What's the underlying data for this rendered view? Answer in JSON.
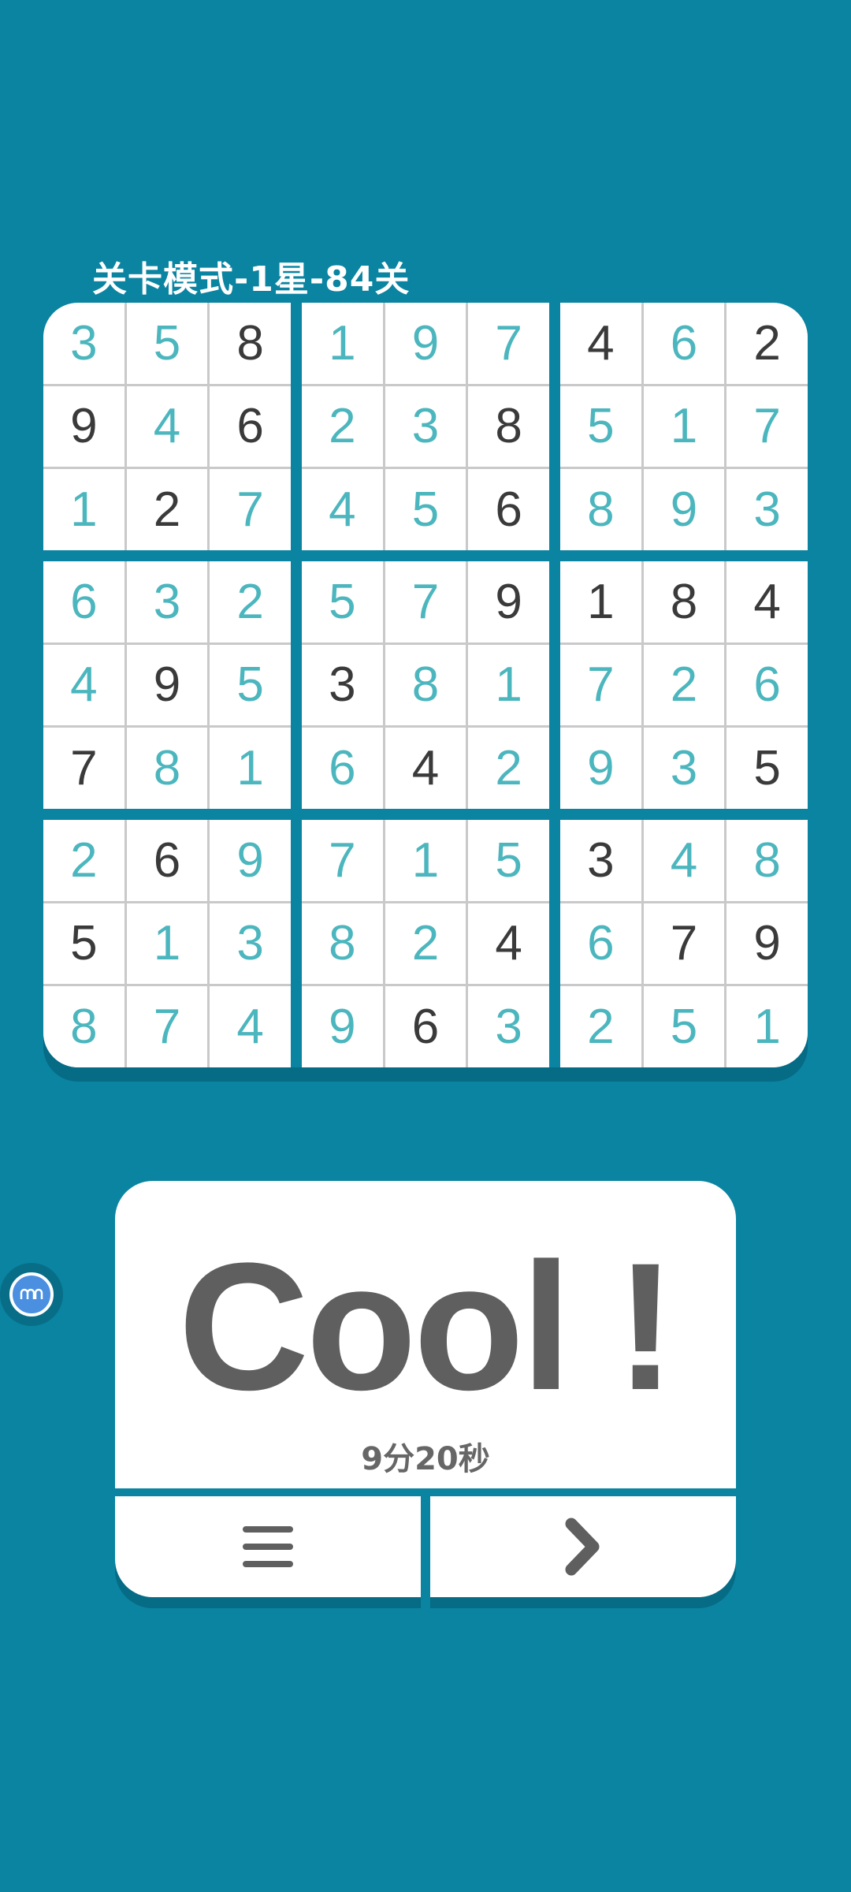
{
  "header": {
    "title": "关卡模式-1星-84关"
  },
  "board": {
    "rows": [
      [
        "3",
        "5",
        "8",
        "1",
        "9",
        "7",
        "4",
        "6",
        "2"
      ],
      [
        "9",
        "4",
        "6",
        "2",
        "3",
        "8",
        "5",
        "1",
        "7"
      ],
      [
        "1",
        "2",
        "7",
        "4",
        "5",
        "6",
        "8",
        "9",
        "3"
      ],
      [
        "6",
        "3",
        "2",
        "5",
        "7",
        "9",
        "1",
        "8",
        "4"
      ],
      [
        "4",
        "9",
        "5",
        "3",
        "8",
        "1",
        "7",
        "2",
        "6"
      ],
      [
        "7",
        "8",
        "1",
        "6",
        "4",
        "2",
        "9",
        "3",
        "5"
      ],
      [
        "2",
        "6",
        "9",
        "7",
        "1",
        "5",
        "3",
        "4",
        "8"
      ],
      [
        "5",
        "1",
        "3",
        "8",
        "2",
        "4",
        "6",
        "7",
        "9"
      ],
      [
        "8",
        "7",
        "4",
        "9",
        "6",
        "3",
        "2",
        "5",
        "1"
      ]
    ],
    "given": [
      [
        0,
        0,
        1,
        0,
        0,
        0,
        1,
        0,
        1
      ],
      [
        1,
        0,
        1,
        0,
        0,
        1,
        0,
        0,
        0
      ],
      [
        0,
        1,
        0,
        0,
        0,
        1,
        0,
        0,
        0
      ],
      [
        0,
        0,
        0,
        0,
        0,
        1,
        1,
        1,
        1
      ],
      [
        0,
        1,
        0,
        1,
        0,
        0,
        0,
        0,
        0
      ],
      [
        1,
        0,
        0,
        0,
        1,
        0,
        0,
        0,
        1
      ],
      [
        0,
        1,
        0,
        0,
        0,
        0,
        1,
        0,
        0
      ],
      [
        1,
        0,
        0,
        0,
        0,
        1,
        0,
        1,
        1
      ],
      [
        0,
        0,
        0,
        0,
        1,
        0,
        0,
        0,
        0
      ]
    ],
    "colors": {
      "given": "#3a3a3a",
      "user": "#4cb6be"
    }
  },
  "result": {
    "message": "Cool !",
    "time": "9分20秒"
  },
  "buttons": {
    "menu_icon": "menu-icon",
    "next_icon": "chevron-right-icon"
  },
  "theme": {
    "background": "#0a84a1"
  }
}
